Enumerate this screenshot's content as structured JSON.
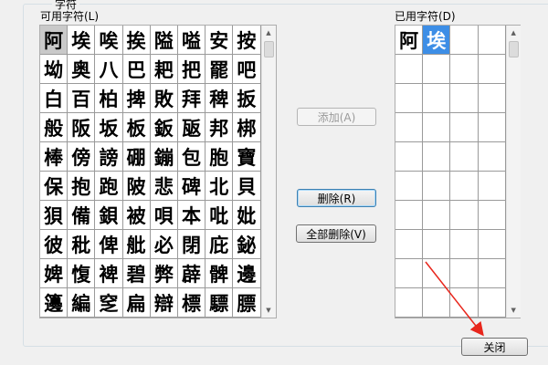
{
  "dialog": {
    "group_label": "字符"
  },
  "available": {
    "label": "可用字符(L)",
    "chars": [
      "阿",
      "埃",
      "唉",
      "挨",
      "隘",
      "嗌",
      "安",
      "按",
      "坳",
      "奥",
      "八",
      "巴",
      "耙",
      "把",
      "罷",
      "吧",
      "白",
      "百",
      "柏",
      "捭",
      "敗",
      "拜",
      "稗",
      "扳",
      "般",
      "阪",
      "坂",
      "板",
      "鈑",
      "瓪",
      "邦",
      "梆",
      "棒",
      "傍",
      "謗",
      "硼",
      "鏰",
      "包",
      "胞",
      "寶",
      "保",
      "抱",
      "跑",
      "陂",
      "悲",
      "碑",
      "北",
      "貝",
      "狽",
      "備",
      "鋇",
      "被",
      "唄",
      "本",
      "吡",
      "妣",
      "彼",
      "秕",
      "俾",
      "舭",
      "必",
      "閉",
      "庇",
      "鉍",
      "婢",
      "愎",
      "裨",
      "碧",
      "弊",
      "薜",
      "髀",
      "邊",
      "籩",
      "編",
      "窆",
      "扁",
      "辯",
      "標",
      "驃",
      "膘"
    ],
    "selected_index": 0
  },
  "chosen": {
    "label": "已用字符(D)",
    "chars": [
      "阿",
      "埃"
    ],
    "selected_index": 1
  },
  "buttons": {
    "add": "添加(A)",
    "delete": "删除(R)",
    "delete_all": "全部删除(V)",
    "close": "关闭"
  },
  "colors": {
    "selection_blue": "#3d8ee6",
    "annotation_arrow": "#e8261c"
  }
}
